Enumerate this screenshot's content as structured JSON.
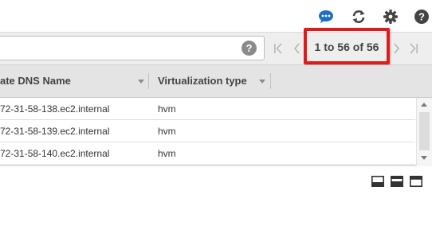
{
  "toolbar": {
    "icons": [
      "chat-icon",
      "refresh-icon",
      "gear-icon",
      "help-icon"
    ],
    "accent_color": "#1c6fc7"
  },
  "filter": {
    "value": "",
    "help_glyph": "?"
  },
  "pager": {
    "text": "1 to 56 of 56",
    "highlight_color": "#e01b1b"
  },
  "table": {
    "columns": [
      "Private DNS Name",
      "Virtualization type"
    ],
    "visible_column_headers": [
      "ate DNS Name",
      "Virtualization type"
    ],
    "rows": [
      {
        "dns": "72-31-58-138.ec2.internal",
        "virt": "hvm"
      },
      {
        "dns": "72-31-58-139.ec2.internal",
        "virt": "hvm"
      },
      {
        "dns": "72-31-58-140.ec2.internal",
        "virt": "hvm"
      }
    ]
  },
  "layout_icons": [
    "layout-bottom-panel-icon",
    "layout-split-panel-icon",
    "layout-top-panel-icon"
  ]
}
